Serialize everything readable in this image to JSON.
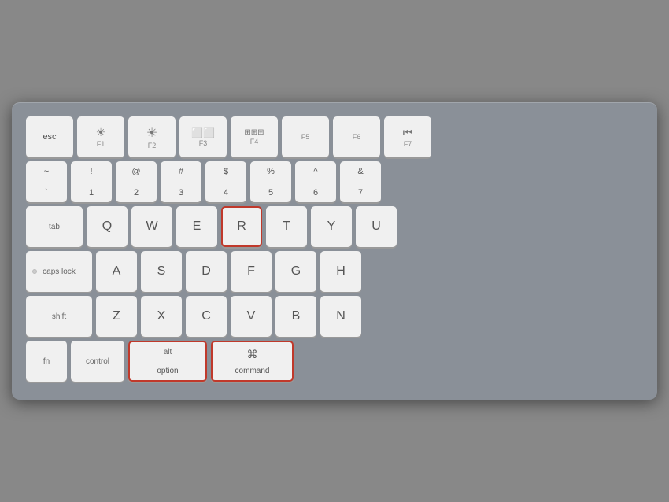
{
  "keyboard": {
    "rows": [
      {
        "id": "row-fn",
        "keys": [
          {
            "id": "esc",
            "label": "esc",
            "type": "esc"
          },
          {
            "id": "f1",
            "top": "☀",
            "bottom": "F1",
            "type": "fn-key"
          },
          {
            "id": "f2",
            "top": "☀",
            "bottom": "F2",
            "type": "fn-key"
          },
          {
            "id": "f3",
            "top": "⊞",
            "bottom": "F3",
            "type": "fn-key"
          },
          {
            "id": "f4",
            "top": "⊞⊞",
            "bottom": "F4",
            "type": "fn-key"
          },
          {
            "id": "f5",
            "top": "",
            "bottom": "F5",
            "type": "fn-key"
          },
          {
            "id": "f6",
            "top": "",
            "bottom": "F6",
            "type": "fn-key"
          },
          {
            "id": "f7",
            "top": "⏮",
            "bottom": "F7",
            "type": "fn-key"
          }
        ]
      },
      {
        "id": "row-num",
        "keys": [
          {
            "id": "backtick",
            "top": "~",
            "bottom": "`",
            "type": "two-line"
          },
          {
            "id": "1",
            "top": "!",
            "bottom": "1",
            "type": "two-line"
          },
          {
            "id": "2",
            "top": "@",
            "bottom": "2",
            "type": "two-line"
          },
          {
            "id": "3",
            "top": "#",
            "bottom": "3",
            "type": "two-line"
          },
          {
            "id": "4",
            "top": "$",
            "bottom": "4",
            "type": "two-line"
          },
          {
            "id": "5",
            "top": "%",
            "bottom": "5",
            "type": "two-line"
          },
          {
            "id": "6",
            "top": "^",
            "bottom": "6",
            "type": "two-line"
          },
          {
            "id": "7",
            "top": "&",
            "bottom": "7",
            "type": "two-line"
          }
        ]
      },
      {
        "id": "row-qwerty",
        "keys": [
          {
            "id": "tab",
            "label": "tab",
            "type": "wide-tab"
          },
          {
            "id": "q",
            "label": "Q",
            "type": "letter"
          },
          {
            "id": "w",
            "label": "W",
            "type": "letter"
          },
          {
            "id": "e",
            "label": "E",
            "type": "letter"
          },
          {
            "id": "r",
            "label": "R",
            "type": "letter",
            "highlighted": true
          },
          {
            "id": "t",
            "label": "T",
            "type": "letter"
          },
          {
            "id": "y",
            "label": "Y",
            "type": "letter"
          },
          {
            "id": "u",
            "label": "U",
            "type": "letter",
            "partial": true
          }
        ]
      },
      {
        "id": "row-asdf",
        "keys": [
          {
            "id": "caps",
            "label": "caps lock",
            "type": "wide-caps",
            "dot": true
          },
          {
            "id": "a",
            "label": "A",
            "type": "letter"
          },
          {
            "id": "s",
            "label": "S",
            "type": "letter"
          },
          {
            "id": "d",
            "label": "D",
            "type": "letter"
          },
          {
            "id": "f",
            "label": "F",
            "type": "letter"
          },
          {
            "id": "g",
            "label": "G",
            "type": "letter"
          },
          {
            "id": "h",
            "label": "H",
            "type": "letter"
          }
        ]
      },
      {
        "id": "row-zxcv",
        "keys": [
          {
            "id": "shift",
            "label": "shift",
            "type": "wide-shift"
          },
          {
            "id": "z",
            "label": "Z",
            "type": "letter"
          },
          {
            "id": "x",
            "label": "X",
            "type": "letter"
          },
          {
            "id": "c",
            "label": "C",
            "type": "letter"
          },
          {
            "id": "v",
            "label": "V",
            "type": "letter"
          },
          {
            "id": "b",
            "label": "B",
            "type": "letter"
          },
          {
            "id": "n",
            "label": "N",
            "type": "letter"
          }
        ]
      },
      {
        "id": "row-bottom",
        "keys": [
          {
            "id": "fn",
            "label": "fn",
            "type": "fn-bottom"
          },
          {
            "id": "control",
            "label": "control",
            "type": "wide-bottom"
          },
          {
            "id": "option",
            "top": "alt",
            "bottom": "option",
            "type": "modifier",
            "highlighted": true
          },
          {
            "id": "command",
            "top": "⌘",
            "bottom": "command",
            "type": "modifier",
            "highlighted": true
          }
        ]
      }
    ]
  }
}
